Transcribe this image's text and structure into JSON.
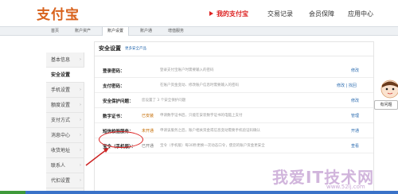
{
  "logo": {
    "text": "支付宝"
  },
  "nav": [
    {
      "label": "我的支付宝",
      "active": true
    },
    {
      "label": "交易记录"
    },
    {
      "label": "会员保障"
    },
    {
      "label": "应用中心"
    }
  ],
  "subnav": [
    "首页",
    "账户资产",
    "账户设置",
    "账户通",
    "增值服务"
  ],
  "sidebar": [
    "基本信息",
    "安全设置",
    "手机设置",
    "额度设置",
    "支付方式",
    "消息中心",
    "收货地址",
    "联系人",
    "代扣设置"
  ],
  "panel": {
    "title": "安全设置",
    "more_link": "更多安全产品",
    "rows": [
      {
        "label": "登录密码：",
        "status": "",
        "desc": "登录支付宝账户时需要输入的密码",
        "action": "修改"
      },
      {
        "label": "支付密码：",
        "status": "",
        "desc": "在账户资金变动、修改账户信息时需要输入的密码",
        "action": "修改 | 找回"
      },
      {
        "label": "安全保护问题：",
        "status": "",
        "desc": "您设置了 3 个安全保护问题",
        "action": "修改"
      },
      {
        "label": "数字证书：",
        "status": "已安装",
        "desc": "申请数字证书后，只能在安装数字证书的电脑上支付",
        "action": "管理"
      },
      {
        "label": "短信校验服务：",
        "status": "未开通",
        "desc": "申请该服务之后，账户相关资金或信息变动需要手机验证码确认",
        "action": "开通"
      },
      {
        "label": "宝令（手机版）：",
        "status": "已开通",
        "desc": "宝令（手机版）每30秒更换一次动态口令，使您的账户资金更安全",
        "action": "查看"
      }
    ]
  },
  "help": {
    "label": "有问题"
  },
  "watermark": {
    "text": "我爱IT技术网",
    "url": "www.52ij.com"
  }
}
